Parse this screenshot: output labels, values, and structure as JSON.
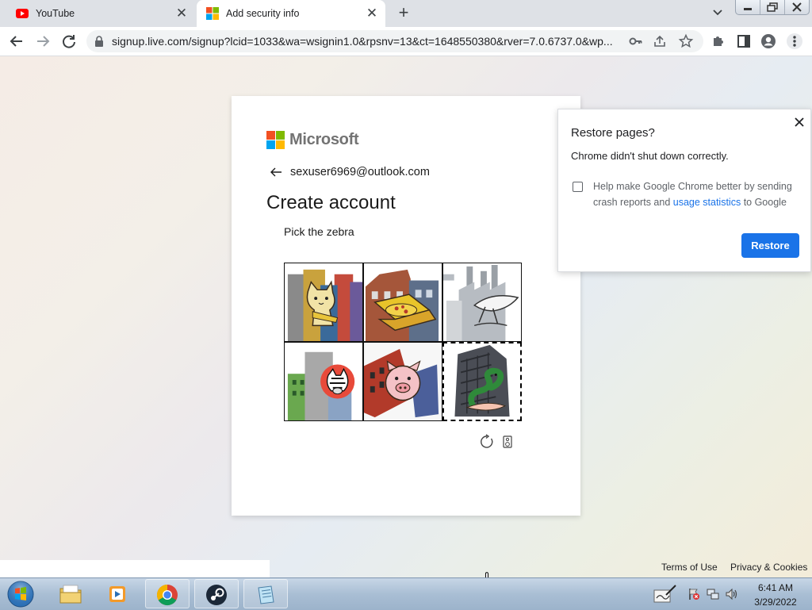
{
  "browser": {
    "tabs": [
      {
        "title": "YouTube",
        "active": false
      },
      {
        "title": "Add security info",
        "active": true
      }
    ],
    "url": "signup.live.com/signup?lcid=1033&wa=wsignin1.0&rpsnv=13&ct=1648550380&rver=7.0.6737.0&wp..."
  },
  "page": {
    "brand": "Microsoft",
    "email": "sexuser6969@outlook.com",
    "heading": "Create account",
    "prompt": "Pick the zebra",
    "captcha_tiles": [
      {
        "subject": "cat",
        "selected": false
      },
      {
        "subject": "pizza",
        "selected": false
      },
      {
        "subject": "bird",
        "selected": false
      },
      {
        "subject": "zebra",
        "selected": false
      },
      {
        "subject": "pig",
        "selected": false
      },
      {
        "subject": "snake",
        "selected": true
      }
    ],
    "footer": {
      "terms": "Terms of Use",
      "privacy": "Privacy & Cookies"
    }
  },
  "restore_popup": {
    "title": "Restore pages?",
    "message": "Chrome didn't shut down correctly.",
    "checkbox_text_before": "Help make Google Chrome better by sending crash reports and ",
    "checkbox_link": "usage statistics",
    "checkbox_text_after": " to Google",
    "checkbox_checked": false,
    "button": "Restore"
  },
  "taskbar": {
    "time": "6:41 AM",
    "date": "3/29/2022"
  },
  "colors": {
    "accent": "#1a73e8",
    "ms_red": "#f25022",
    "ms_green": "#7fba00",
    "ms_blue": "#00a4ef",
    "ms_yellow": "#ffb900"
  }
}
